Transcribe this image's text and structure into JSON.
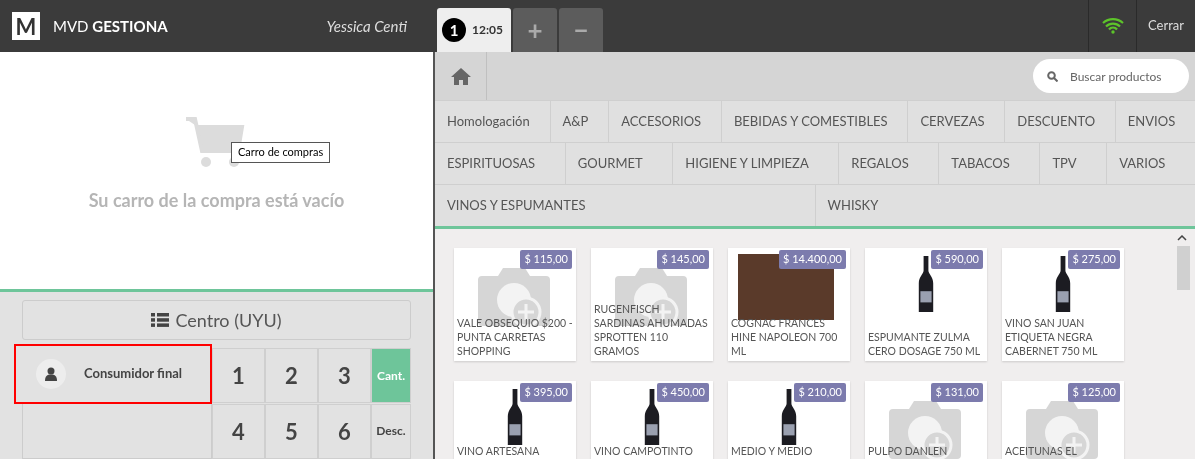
{
  "header": {
    "brand_letter": "M",
    "brand_light": "MVD",
    "brand_bold": "GESTIONA",
    "user": "Yessica Centi",
    "close": "Cerrar"
  },
  "order_tabs": [
    {
      "kind": "order",
      "number": "1",
      "time": "12:05",
      "selected": true
    },
    {
      "kind": "add",
      "label": "+",
      "selected": false
    },
    {
      "kind": "remove",
      "label": "−",
      "selected": false
    }
  ],
  "cart": {
    "tooltip": "Carro de compras",
    "empty_message": "Su carro de la compra está vacío"
  },
  "pricelist": "Centro (UYU)",
  "customer": {
    "label": "Consumidor final",
    "highlighted": true
  },
  "keypad": [
    {
      "label": "1",
      "selected": false
    },
    {
      "label": "2",
      "selected": false
    },
    {
      "label": "3",
      "selected": false
    },
    {
      "label": "Cant.",
      "selected": true
    },
    {
      "label": "4",
      "selected": false
    },
    {
      "label": "5",
      "selected": false
    },
    {
      "label": "6",
      "selected": false
    },
    {
      "label": "Desc.",
      "selected": false
    }
  ],
  "search": {
    "placeholder": "Buscar productos"
  },
  "category_rows": [
    [
      "Homologación",
      "A&P",
      "ACCESORIOS",
      "BEBIDAS Y COMESTIBLES",
      "CERVEZAS",
      "DESCUENTO",
      "ENVIOS"
    ],
    [
      "ESPIRITUOSAS",
      "GOURMET",
      "HIGIENE Y LIMPIEZA",
      "REGALOS",
      "TABACOS",
      "TPV",
      "VARIOS"
    ],
    [
      "VINOS Y ESPUMANTES",
      "WHISKY"
    ]
  ],
  "products": [
    {
      "name": "VALE OBSEQUIO $200 - PUNTA CARRETAS SHOPPING",
      "price": "$ 115,00",
      "kind": "no-image"
    },
    {
      "name": "RUGENFISCH SARDINAS AHUMADAS SPROTTEN 110 GRAMOS",
      "price": "$ 145,00",
      "kind": "no-image"
    },
    {
      "name": "COGNAC FRANCES HINE NAPOLEON 700 ML",
      "price": "$ 14.400,00",
      "kind": "photo"
    },
    {
      "name": "ESPUMANTE ZULMA CERO DOSAGE 750 ML",
      "price": "$ 590,00",
      "kind": "bottle"
    },
    {
      "name": "VINO SAN JUAN ETIQUETA NEGRA CABERNET 750 ML",
      "price": "$ 275,00",
      "kind": "bottle"
    },
    {
      "name": "VINO ARTESANA",
      "price": "$ 395,00",
      "kind": "bottle"
    },
    {
      "name": "VINO CAMPOTINTO",
      "price": "$ 450,00",
      "kind": "bottle"
    },
    {
      "name": "MEDIO Y MEDIO",
      "price": "$ 210,00",
      "kind": "bottle"
    },
    {
      "name": "PULPO DANLEN",
      "price": "$ 131,00",
      "kind": "no-image"
    },
    {
      "name": "ACEITUNAS EL",
      "price": "$ 125,00",
      "kind": "no-image"
    }
  ]
}
